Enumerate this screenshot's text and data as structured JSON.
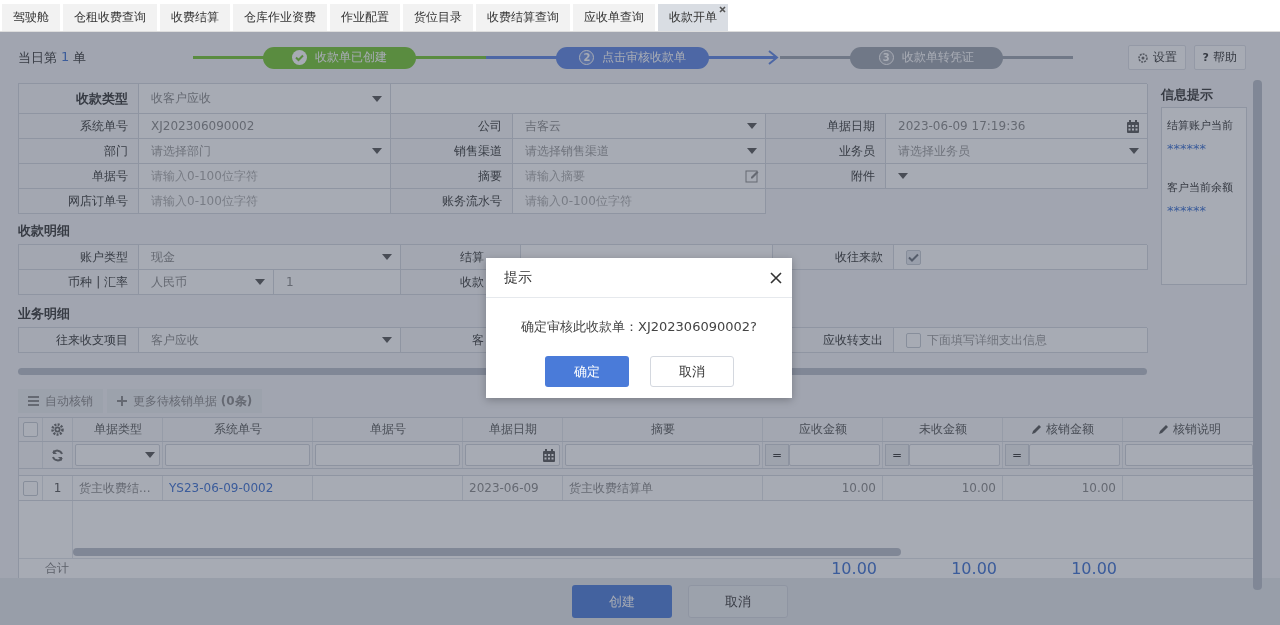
{
  "tabs": [
    {
      "label": "驾驶舱",
      "selected": false,
      "closable": false
    },
    {
      "label": "仓租收费查询",
      "selected": false,
      "closable": false
    },
    {
      "label": "收费结算",
      "selected": false,
      "closable": false
    },
    {
      "label": "仓库作业资费",
      "selected": false,
      "closable": false
    },
    {
      "label": "作业配置",
      "selected": false,
      "closable": false
    },
    {
      "label": "货位目录",
      "selected": false,
      "closable": false
    },
    {
      "label": "收费结算查询",
      "selected": false,
      "closable": false
    },
    {
      "label": "应收单查询",
      "selected": false,
      "closable": false
    },
    {
      "label": "收款开单",
      "selected": true,
      "closable": true
    }
  ],
  "header": {
    "prefix": "当日第",
    "count": "1",
    "suffix": "单"
  },
  "steps": [
    {
      "label": "收款单已创建",
      "completed": true,
      "current": false
    },
    {
      "number": "2",
      "label": "点击审核收款单",
      "completed": false,
      "current": true
    },
    {
      "number": "3",
      "label": "收款单转凭证",
      "completed": false,
      "current": false
    }
  ],
  "tools": [
    {
      "label": "设置"
    },
    {
      "mark": "?",
      "label": "帮助"
    }
  ],
  "form": [
    [
      {
        "label": "收款类型",
        "strong": true,
        "kind": "select",
        "value": "收客户应收"
      }
    ],
    [
      {
        "label": "系统单号",
        "kind": "text",
        "value": "XJ202306090002"
      },
      {
        "label": "公司",
        "kind": "select",
        "value": "吉客云"
      },
      {
        "label": "单据日期",
        "kind": "date",
        "value": "2023-06-09 17:19:36"
      }
    ],
    [
      {
        "label": "部门",
        "kind": "select",
        "placeholder": "请选择部门"
      },
      {
        "label": "销售渠道",
        "kind": "select",
        "placeholder": "请选择销售渠道"
      },
      {
        "label": "业务员",
        "kind": "select",
        "placeholder": "请选择业务员"
      }
    ],
    [
      {
        "label": "单据号",
        "kind": "input",
        "placeholder": "请输入0-100位字符"
      },
      {
        "label": "摘要",
        "kind": "memo",
        "placeholder": "请输入摘要"
      },
      {
        "label": "附件",
        "kind": "select"
      }
    ],
    [
      {
        "label": "网店订单号",
        "kind": "input",
        "placeholder": "请输入0-100位字符"
      },
      {
        "label": "账务流水号",
        "kind": "input",
        "placeholder": "请输入0-100位字符"
      }
    ]
  ],
  "info": {
    "title": "信息提示",
    "items": [
      {
        "label": "结算账户当前",
        "value": "******"
      },
      {
        "label": "客户当前余额",
        "value": "******"
      }
    ]
  },
  "sections": [
    {
      "title": "收款明细",
      "rows": [
        [
          {
            "label": "账户类型",
            "kind": "select",
            "value": "现金"
          },
          {
            "label": "结算",
            "kind": "blank"
          },
          {
            "label": "收往来款",
            "kind": "checkbox",
            "checked": true
          }
        ],
        [
          {
            "label": "币种 | 汇率",
            "kind": "currency",
            "value": "人民币",
            "rate": "1"
          },
          {
            "label": "收款",
            "kind": "covered"
          }
        ]
      ]
    },
    {
      "title": "业务明细",
      "rows": [
        [
          {
            "label": "往来收支项目",
            "kind": "select",
            "value": "客户应收"
          },
          {
            "label": "客",
            "kind": "covered"
          },
          {
            "label": "应收转支出",
            "kind": "checkbox",
            "checked": false,
            "text": "下面填写详细支出信息"
          }
        ]
      ]
    }
  ],
  "toolbar": [
    "自动核销",
    "更多待核销单据 **(0条)**"
  ],
  "table": {
    "all_checked": false,
    "columns": [
      {
        "label": "单据类型",
        "kind": "select"
      },
      {
        "label": "系统单号",
        "kind": "text",
        "link": true
      },
      {
        "label": "单据号",
        "kind": "text"
      },
      {
        "label": "单据日期",
        "kind": "date"
      },
      {
        "label": "摘要",
        "kind": "text"
      },
      {
        "label": "应收金额",
        "kind": "number",
        "operator": "="
      },
      {
        "label": "未收金额",
        "kind": "number",
        "operator": "="
      },
      {
        "label": "核销金额",
        "kind": "number",
        "operator": "=",
        "editable": true
      },
      {
        "label": "核销说明",
        "kind": "text",
        "editable": true
      }
    ],
    "rows": [
      {
        "checked": false,
        "index": "1",
        "cells": [
          "货主收费结...",
          "YS23-06-09-0002",
          null,
          "2023-06-09",
          "货主收费结算单",
          "10.00",
          "10.00",
          "10.00",
          null
        ]
      }
    ],
    "totals": {
      "label": "合计",
      "cells": [
        null,
        null,
        null,
        null,
        null,
        "10.00",
        "10.00",
        "10.00",
        null
      ]
    }
  },
  "footer": [
    {
      "label": "创建",
      "kind": "primary"
    },
    {
      "label": "取消",
      "kind": "default"
    }
  ],
  "dialog": {
    "title": "提示",
    "message": "确定审核此收款单：XJ202306090002?",
    "buttons": [
      {
        "label": "确定",
        "kind": "primary"
      },
      {
        "label": "取消",
        "kind": "default"
      }
    ]
  }
}
